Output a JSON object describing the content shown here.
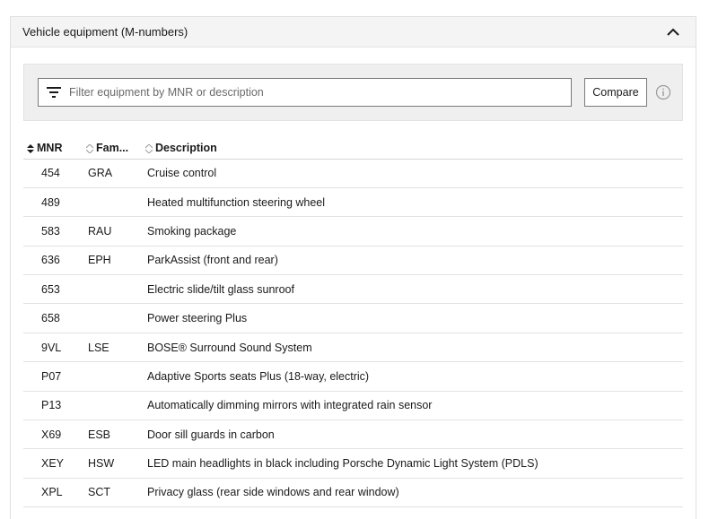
{
  "panel": {
    "title": "Vehicle equipment (M-numbers)"
  },
  "filter": {
    "placeholder": "Filter equipment by MNR or description",
    "compare_label": "Compare"
  },
  "table": {
    "headers": {
      "mnr": "MNR",
      "family": "Fam...",
      "description": "Description"
    },
    "rows": [
      {
        "mnr": "454",
        "family": "GRA",
        "description": "Cruise control"
      },
      {
        "mnr": "489",
        "family": "",
        "description": "Heated multifunction steering wheel"
      },
      {
        "mnr": "583",
        "family": "RAU",
        "description": "Smoking package"
      },
      {
        "mnr": "636",
        "family": "EPH",
        "description": "ParkAssist (front and rear)"
      },
      {
        "mnr": "653",
        "family": "",
        "description": "Electric slide/tilt glass sunroof"
      },
      {
        "mnr": "658",
        "family": "",
        "description": "Power steering Plus"
      },
      {
        "mnr": "9VL",
        "family": "LSE",
        "description": "BOSE® Surround Sound System"
      },
      {
        "mnr": "P07",
        "family": "",
        "description": "Adaptive Sports seats Plus (18-way, electric)"
      },
      {
        "mnr": "P13",
        "family": "",
        "description": "Automatically dimming mirrors with integrated rain sensor"
      },
      {
        "mnr": "X69",
        "family": "ESB",
        "description": "Door sill guards in carbon"
      },
      {
        "mnr": "XEY",
        "family": "HSW",
        "description": "LED main headlights in black including Porsche Dynamic Light System (PDLS)"
      },
      {
        "mnr": "XPL",
        "family": "SCT",
        "description": "Privacy glass (rear side windows and rear window)"
      }
    ]
  },
  "icons": {
    "collapse": "chevron-up-icon",
    "filter": "filter-icon",
    "info": "info-icon",
    "sort": "sort-icon"
  }
}
